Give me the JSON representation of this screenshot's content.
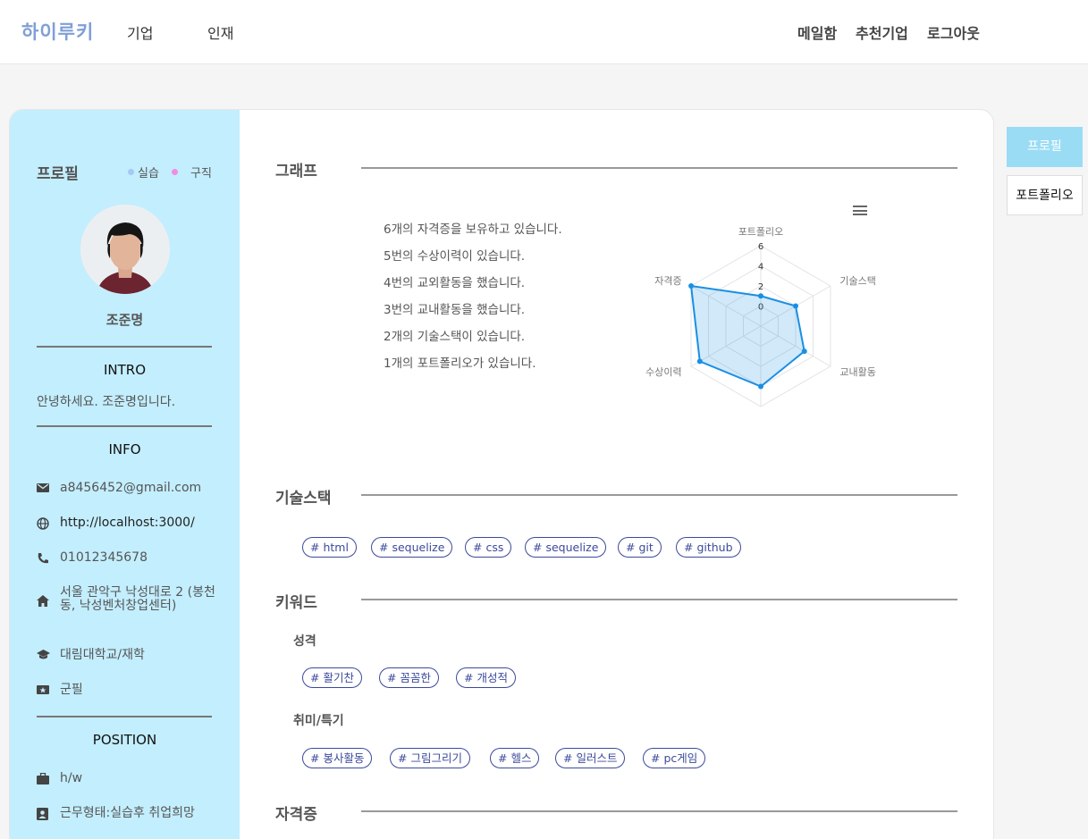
{
  "header": {
    "logo": "하이루키",
    "nav_left": [
      "기업",
      "인재"
    ],
    "nav_right": [
      "메일함",
      "추천기업",
      "로그아웃"
    ]
  },
  "profile": {
    "title": "프로필",
    "legend": [
      {
        "label": "실습",
        "color": "#a6c8f5"
      },
      {
        "label": "구직",
        "color": "#f08ce6"
      }
    ],
    "name": "조준명",
    "intro_head": "INTRO",
    "intro_text": "안녕하세요. 조준명입니다.",
    "info_head": "INFO",
    "info": [
      {
        "icon": "mail-icon",
        "text": "a8456452@gmail.com"
      },
      {
        "icon": "globe-icon",
        "text": "http://localhost:3000/"
      },
      {
        "icon": "phone-icon",
        "text": "01012345678"
      },
      {
        "icon": "home-icon",
        "text": "서울 관악구 낙성대로 2 (봉천동, 낙성벤처창업센터)"
      },
      {
        "icon": "graduation-cap-icon",
        "text": "대림대학교/재학"
      },
      {
        "icon": "military-badge-icon",
        "text": "군필"
      }
    ],
    "position_head": "POSITION",
    "position": [
      {
        "icon": "briefcase-icon",
        "text": "h/w"
      },
      {
        "icon": "id-badge-icon",
        "text": "근무형태:실습후 취업희망"
      }
    ]
  },
  "sections": {
    "graph": "그래프",
    "tech": "기술스택",
    "keyword": "키워드",
    "cert": "자격증"
  },
  "stats": [
    "6개의 자격증을 보유하고 있습니다.",
    "5번의 수상이력이 있습니다.",
    "4번의 교외활동을 했습니다.",
    "3번의 교내활동을 했습니다.",
    "2개의 기술스택이 있습니다.",
    "1개의 포트폴리오가 있습니다."
  ],
  "chart_data": {
    "type": "radar",
    "categories": [
      "포트폴리오",
      "기술스택",
      "교내활동",
      "교외활동",
      "수상이력",
      "자격증"
    ],
    "values": [
      1,
      2,
      3,
      4,
      5,
      6
    ],
    "ticks": [
      "0",
      "2",
      "4",
      "6"
    ],
    "range": [
      -2,
      6
    ],
    "color": "#1a8fe3"
  },
  "tech_tags": [
    "# html",
    "# sequelize",
    "# css",
    "# sequelize",
    "# git",
    "# github"
  ],
  "keywords": {
    "personality_head": "성격",
    "personality": [
      "# 활기찬",
      "# 꼼꼼한",
      "# 개성적"
    ],
    "hobby_head": "취미/특기",
    "hobby": [
      "# 봉사활동",
      "# 그림그리기",
      "# 헬스",
      "# 일러스트",
      "# pc게임"
    ]
  },
  "side_tabs": [
    "프로필",
    "포트폴리오"
  ]
}
